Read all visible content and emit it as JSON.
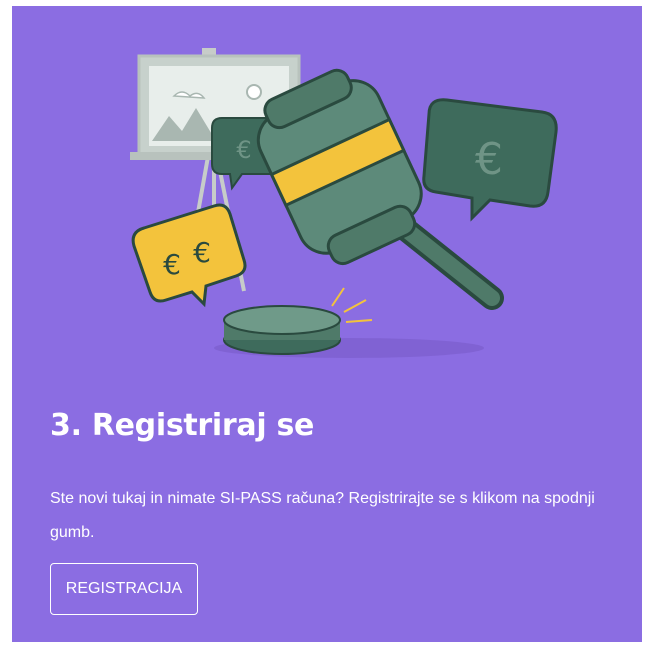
{
  "step": {
    "title": "3. Registriraj se",
    "description": "Ste novi tukaj in nimate SI-PASS računa? Registrirajte se s klikom na spodnji gumb.",
    "button_label": "REGISTRACIJA"
  },
  "colors": {
    "card_background": "#8b6de2",
    "text": "#ffffff",
    "illustration_dark_green": "#3e6b5c",
    "illustration_yellow": "#f3c33c"
  },
  "icons": [
    "auction-gavel-illustration",
    "euro-bubble-icon",
    "easel-painting-icon"
  ]
}
